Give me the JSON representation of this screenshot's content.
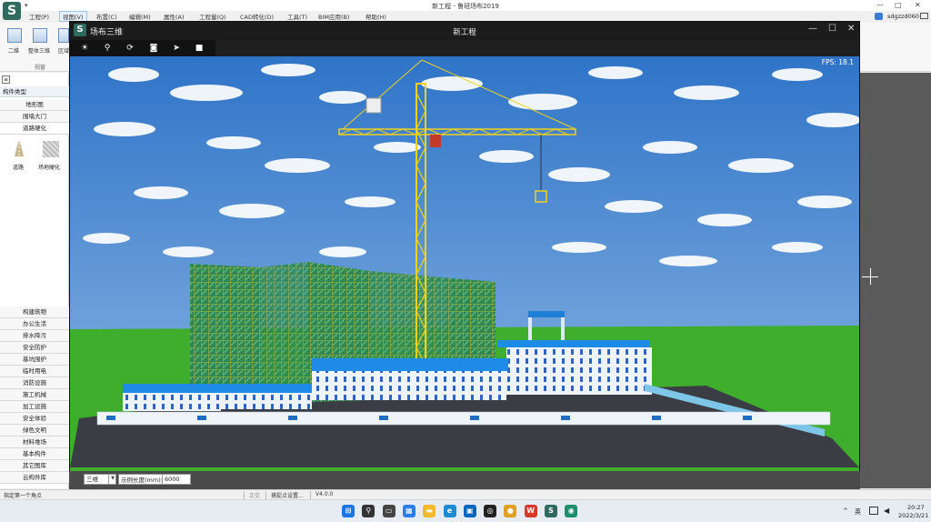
{
  "app": {
    "logo": "S",
    "quick_access": "▾",
    "title": "新工程 - 鲁班场布2019",
    "window_controls": [
      "—",
      "□",
      "✕"
    ]
  },
  "menu": {
    "items": [
      "工程(P)",
      "视图(V)",
      "布置(C)",
      "编辑(M)",
      "属性(A)",
      "工程量(Q)",
      "CAD转化(D)",
      "工具(T)",
      "BIM应用(B)",
      "帮助(H)"
    ],
    "active_index": 1
  },
  "user": {
    "cloud_icon": "cloud-icon",
    "name": "sdgzzd060",
    "msg_icon": "mail-icon"
  },
  "ribbon": {
    "buttons": [
      {
        "label": "二维",
        "icon": "plan-2d-icon"
      },
      {
        "label": "整体三维",
        "icon": "cube-3d-icon"
      },
      {
        "label": "区域",
        "icon": "region-icon"
      }
    ],
    "group_label": "视窗"
  },
  "left_panel": {
    "header": "构件类型",
    "top_categories": [
      "地形图",
      "围墙大门",
      "道路硬化"
    ],
    "selected_category": "道路硬化",
    "tools": [
      {
        "label": "道路",
        "icon": "road-icon"
      },
      {
        "label": "场地硬化",
        "icon": "hardened-ground-icon"
      }
    ],
    "bottom_categories": [
      "构建筑物",
      "办公生活",
      "排水降污",
      "安全防护",
      "基坑围护",
      "临时用电",
      "消防设施",
      "施工机械",
      "加工设施",
      "安全体验",
      "绿色文明",
      "材料堆场",
      "基本构件",
      "其它图库",
      "云构件库"
    ]
  },
  "bottom_inputs": {
    "view_mode": "三维",
    "length_label": "示例长度(mm):",
    "length_value": "6000"
  },
  "status_bar": {
    "prompt": "指定第一个角点",
    "snap_label": "正交",
    "capture_settings": "捕捉点设置...",
    "version": "V4.0.0"
  },
  "win3d": {
    "logo": "S",
    "app_name": "场布三维",
    "title": "新工程",
    "controls": [
      "—",
      "☐",
      "✕"
    ],
    "tools": [
      {
        "name": "sun-icon",
        "glyph": "☀"
      },
      {
        "name": "location-pin-icon",
        "glyph": "⚲"
      },
      {
        "name": "rotate-icon",
        "glyph": "⟳"
      },
      {
        "name": "camera-icon",
        "glyph": "◙"
      },
      {
        "name": "send-icon",
        "glyph": "➤"
      },
      {
        "name": "video-camera-icon",
        "glyph": "■"
      }
    ],
    "fps": "FPS: 18.1"
  },
  "taskbar": {
    "icons": [
      {
        "name": "windows-start-icon",
        "glyph": "⊞",
        "color": "#1a73e8"
      },
      {
        "name": "search-icon",
        "glyph": "⚲",
        "color": "#333333"
      },
      {
        "name": "task-view-icon",
        "glyph": "▭",
        "color": "#444444"
      },
      {
        "name": "widgets-icon",
        "glyph": "▦",
        "color": "#2b7de9"
      },
      {
        "name": "file-explorer-icon",
        "glyph": "▬",
        "color": "#f2b92b"
      },
      {
        "name": "edge-icon",
        "glyph": "e",
        "color": "#1f8ad2"
      },
      {
        "name": "store-icon",
        "glyph": "▣",
        "color": "#0067c0"
      },
      {
        "name": "app-gear-icon",
        "glyph": "◎",
        "color": "#222222"
      },
      {
        "name": "app-chrome-icon",
        "glyph": "●",
        "color": "#e0a020"
      },
      {
        "name": "wps-icon",
        "glyph": "W",
        "color": "#d73a2a"
      },
      {
        "name": "luban-icon",
        "glyph": "S",
        "color": "#2f6a5e"
      },
      {
        "name": "app-circle-icon",
        "glyph": "◉",
        "color": "#1d8f6a"
      }
    ],
    "tray_caret": "^",
    "ime": "英",
    "time": "20:27",
    "date": "2022/3/21"
  }
}
